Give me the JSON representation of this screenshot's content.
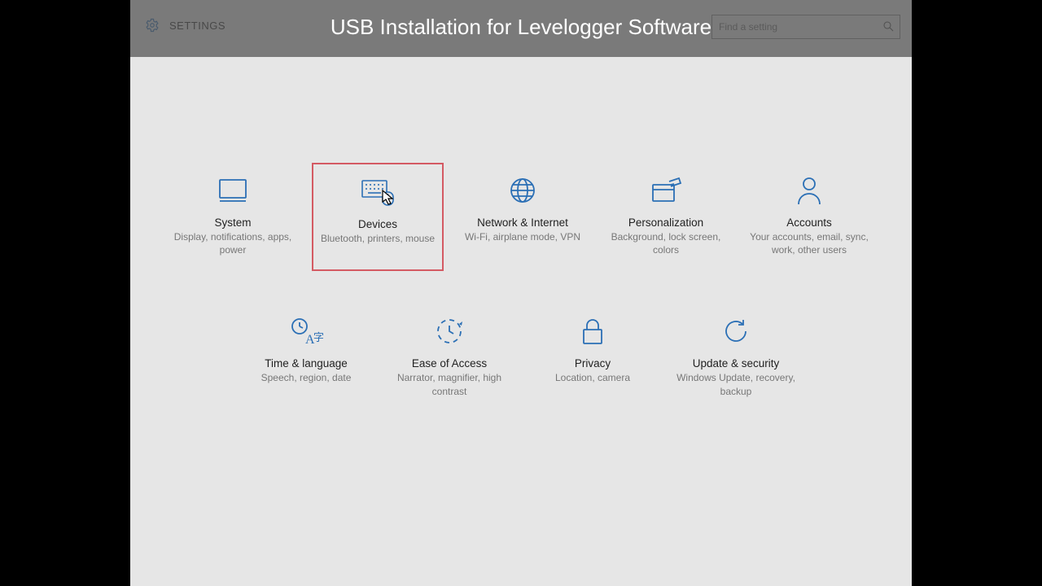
{
  "banner": {
    "title": "USB Installation for Levelogger Software"
  },
  "header": {
    "label": "SETTINGS",
    "search_placeholder": "Find a setting"
  },
  "tiles": [
    {
      "id": "system",
      "name": "System",
      "desc": "Display, notifications, apps, power",
      "icon": "display-icon"
    },
    {
      "id": "devices",
      "name": "Devices",
      "desc": "Bluetooth, printers, mouse",
      "icon": "keyboard-icon",
      "highlight": true,
      "cursor": true
    },
    {
      "id": "network",
      "name": "Network & Internet",
      "desc": "Wi-Fi, airplane mode, VPN",
      "icon": "globe-icon"
    },
    {
      "id": "personalization",
      "name": "Personalization",
      "desc": "Background, lock screen, colors",
      "icon": "paint-icon"
    },
    {
      "id": "accounts",
      "name": "Accounts",
      "desc": "Your accounts, email, sync, work, other users",
      "icon": "person-icon"
    },
    {
      "id": "time-language",
      "name": "Time & language",
      "desc": "Speech, region, date",
      "icon": "time-lang-icon"
    },
    {
      "id": "ease-of-access",
      "name": "Ease of Access",
      "desc": "Narrator, magnifier, high contrast",
      "icon": "ease-icon"
    },
    {
      "id": "privacy",
      "name": "Privacy",
      "desc": "Location, camera",
      "icon": "lock-icon"
    },
    {
      "id": "update-security",
      "name": "Update & security",
      "desc": "Windows Update, recovery, backup",
      "icon": "update-icon"
    }
  ]
}
